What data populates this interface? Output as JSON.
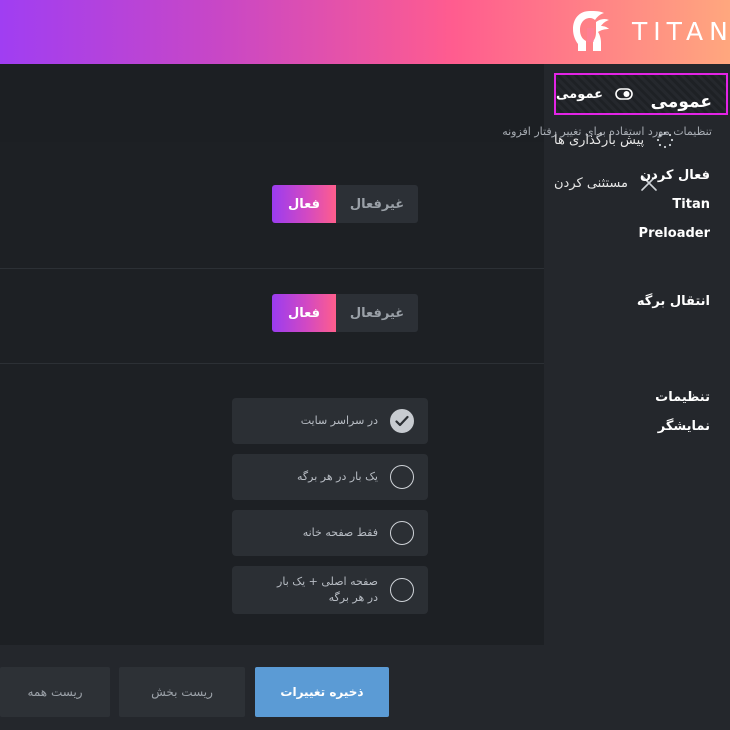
{
  "header": {
    "brand": "TITAN"
  },
  "sidebar": {
    "items": [
      {
        "label": "عمومی",
        "icon": "toggle-icon",
        "active": true
      },
      {
        "label": "پیش بارگذاری ها",
        "icon": "spinner-icon",
        "active": false
      },
      {
        "label": "مستثنی کردن",
        "icon": "close-icon",
        "active": false
      }
    ]
  },
  "page": {
    "title": "عمومی",
    "description": "تنظیمات مورد استفاده برای تغییر رفتار افزونه"
  },
  "settings": {
    "enable": {
      "label": "فعال کردن Titan Preloader",
      "on_label": "فعال",
      "off_label": "غیرفعال",
      "value": "فعال"
    },
    "page_transition": {
      "label": "انتقال برگه",
      "on_label": "فعال",
      "off_label": "غیرفعال",
      "value": "فعال"
    },
    "display": {
      "label": "تنظیمات نمایشگر",
      "options": [
        {
          "text": "در سراسر سایت",
          "checked": true
        },
        {
          "text": "یک بار در هر برگه",
          "checked": false
        },
        {
          "text": "فقط صفحه خانه",
          "checked": false
        },
        {
          "text": "صفحه اصلی + یک بار در هر برگه",
          "checked": false
        }
      ]
    }
  },
  "actions": {
    "save_label": "ذخیره تغییرات",
    "reset_section_label": "ریست بخش",
    "reset_all_label": "ریست همه"
  },
  "colors": {
    "accent_gradient_start": "#9a3cf0",
    "accent_gradient_end": "#ff5e8c",
    "active_border": "#e324e6",
    "save_button": "#5b9bd5",
    "background": "#1d2024"
  }
}
